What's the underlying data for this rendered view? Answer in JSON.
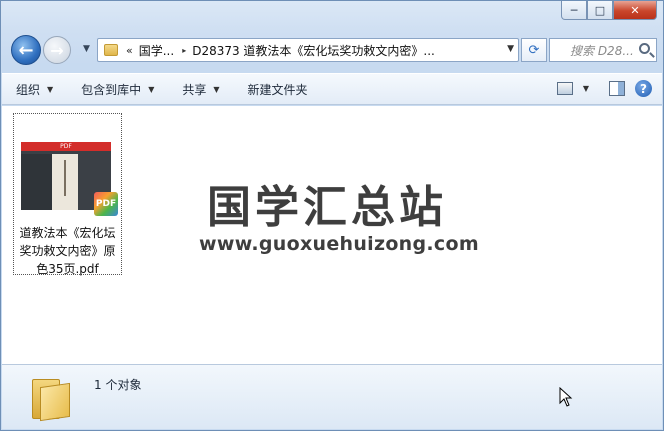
{
  "window": {
    "caption": {
      "minimize": "─",
      "maximize": "□",
      "close": "✕"
    }
  },
  "nav": {
    "back_glyph": "←",
    "forward_glyph": "→",
    "address": {
      "overflow_glyph": "«",
      "crumbs": [
        "国学...",
        "D28373 道教法本《宏化坛奖功敕文内密》..."
      ],
      "separator_glyph": "▸"
    },
    "refresh_glyph": "⟳",
    "search": {
      "placeholder": "搜索 D28..."
    }
  },
  "toolbar": {
    "organize": "组织",
    "include_in_library": "包含到库中",
    "share": "共享",
    "new_folder": "新建文件夹",
    "help_glyph": "?"
  },
  "content": {
    "file": {
      "name": "道教法本《宏化坛奖功敕文内密》原色35页.pdf",
      "thumb_header": "PDF",
      "badge": "PDF"
    },
    "watermark": {
      "title": "国学汇总站",
      "url": "www.guoxuehuizong.com"
    }
  },
  "details": {
    "count": "1 个对象"
  },
  "icons": {
    "folder": "folder-icon",
    "pdf": "pdf-icon",
    "search": "search-icon",
    "help": "help-icon"
  }
}
